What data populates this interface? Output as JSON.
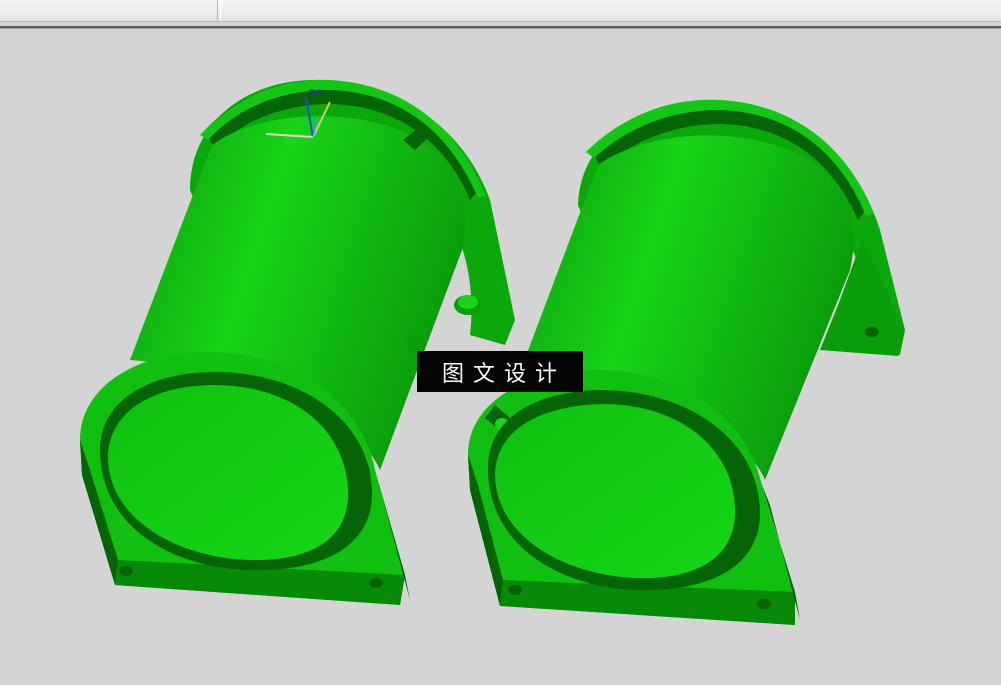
{
  "watermark": {
    "text": "图文设计"
  },
  "triad": {
    "z_label": "ZC"
  },
  "colors": {
    "background": "#d4d4d4",
    "part_light": "#16cc16",
    "part_mid": "#0aa80a",
    "part_dark": "#056405",
    "axis_z": "#2050d0",
    "axis_x": "#e0b070"
  },
  "parts": [
    {
      "name": "cylindrical-bracket-left"
    },
    {
      "name": "cylindrical-bracket-right"
    }
  ]
}
